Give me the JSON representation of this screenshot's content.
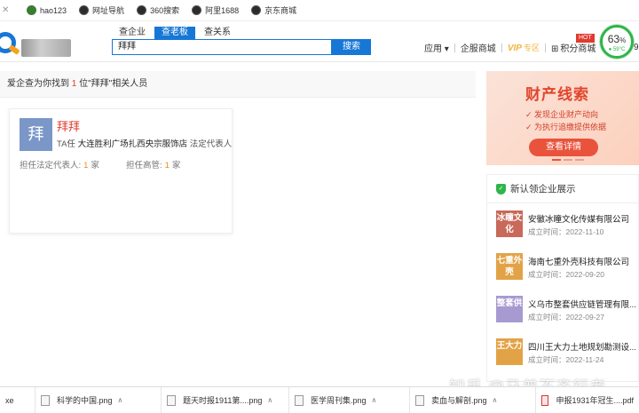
{
  "bookmarks": [
    {
      "label": "",
      "icon": "close-icon"
    },
    {
      "label": "hao123",
      "icon": "hao123-icon"
    },
    {
      "label": "网址导航",
      "icon": "globe-icon"
    },
    {
      "label": "360搜索",
      "icon": "globe-icon"
    },
    {
      "label": "阿里1688",
      "icon": "globe-icon"
    },
    {
      "label": "京东商城",
      "icon": "globe-icon"
    }
  ],
  "search": {
    "tabs": [
      "查企业",
      "查老板",
      "查关系"
    ],
    "active_tab": "查老板",
    "value": "拜拜",
    "button_label": "搜索"
  },
  "nav": {
    "apps_label": "应用",
    "mall_label": "企服商城",
    "vip_label": "VIP",
    "vip_suffix": "专区",
    "points_label": "积分商城",
    "hot_badge": "HOT",
    "cut_label": "9"
  },
  "gauge": {
    "percent": "63",
    "unit": "%",
    "temp": "59°C"
  },
  "result": {
    "prefix": "爱企查为你找到",
    "count": "1",
    "suffix": "位\"拜拜\"相关人员"
  },
  "person": {
    "avatar_char": "拜",
    "name": "拜拜",
    "ta_label": "TA任",
    "company": "大连胜利广场扎西央宗服饰店",
    "role": "法定代表人",
    "stat1_label": "担任法定代表人:",
    "stat1_value": "1",
    "stat1_unit": "家",
    "stat2_label": "担任高管:",
    "stat2_value": "1",
    "stat2_unit": "家"
  },
  "banner": {
    "title": "财产线索",
    "line1": "发现企业财产动向",
    "line2": "为执行追缴提供依据",
    "button": "查看详情"
  },
  "new_ent": {
    "title": "新认领企业展示",
    "items": [
      {
        "tag": "冰瞳文化",
        "name": "安徽冰瞳文化传媒有限公司",
        "date": "成立时间：2022-11-10",
        "color": "#c8695a"
      },
      {
        "tag": "七重外壳",
        "name": "海南七重外壳科技有限公司",
        "date": "成立时间：2022-09-20",
        "color": "#e2a347"
      },
      {
        "tag": "整套供",
        "name": "义乌市整套供应链管理有限...",
        "date": "成立时间：2022-09-27",
        "color": "#a79ad0"
      },
      {
        "tag": "王大力",
        "name": "四川王大力土地规划勘测设...",
        "date": "成立时间：2022-11-24",
        "color": "#e2a347"
      }
    ]
  },
  "watermark": "知乎 @马普不齐行者",
  "downloads": [
    {
      "name": "xe",
      "type": "file"
    },
    {
      "name": "科学的中国.png",
      "type": "png"
    },
    {
      "name": "题天时报1911第....png",
      "type": "png"
    },
    {
      "name": "医学周刊集.png",
      "type": "png"
    },
    {
      "name": "卖血与解剖.png",
      "type": "png"
    },
    {
      "name": "申报1931年冠生....pdf",
      "type": "pdf"
    }
  ]
}
